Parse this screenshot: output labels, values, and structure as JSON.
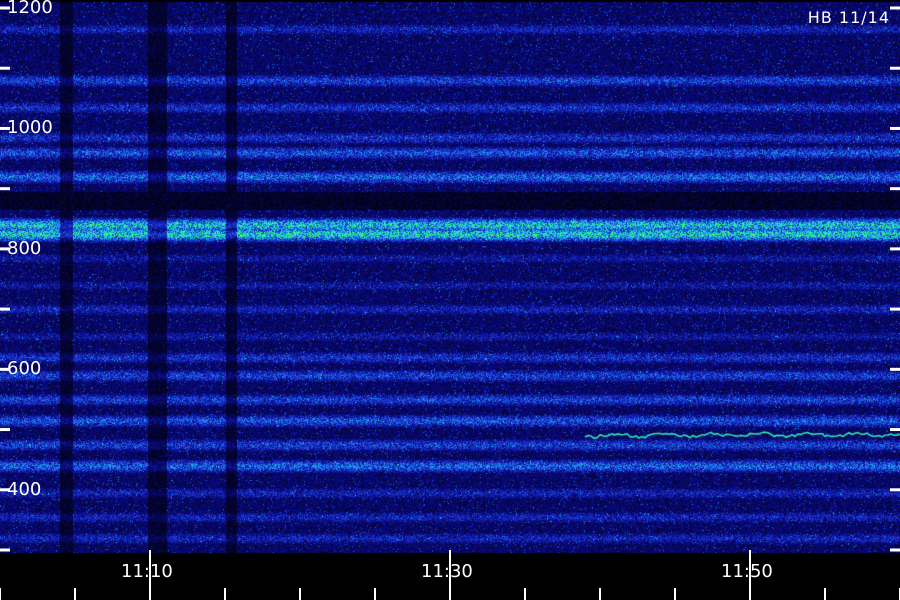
{
  "chart_data": {
    "type": "heatmap",
    "annotation": "HB 11/14",
    "y_axis": {
      "range": [
        300,
        1200
      ],
      "labels": [
        "1200",
        "1000",
        "800",
        "600",
        "400"
      ],
      "label_values": [
        1200,
        1000,
        800,
        600,
        400
      ],
      "tick_values": [
        1100,
        900,
        700,
        500,
        300
      ]
    },
    "x_axis": {
      "labels": [
        "11:10",
        "11:30",
        "11:50"
      ],
      "label_values": [
        "11:10",
        "11:30",
        "11:50"
      ],
      "range": [
        "11:00",
        "12:00"
      ]
    },
    "bands": [
      {
        "level": 1165,
        "intensity": 0.35
      },
      {
        "level": 1080,
        "intensity": 0.45
      },
      {
        "level": 1035,
        "intensity": 0.4
      },
      {
        "level": 985,
        "intensity": 0.4
      },
      {
        "level": 960,
        "intensity": 0.5
      },
      {
        "level": 920,
        "intensity": 0.55
      },
      {
        "level": 880,
        "intensity": 0.05
      },
      {
        "level": 840,
        "intensity": 0.85
      },
      {
        "level": 825,
        "intensity": 0.9
      },
      {
        "level": 785,
        "intensity": 0.3
      },
      {
        "level": 740,
        "intensity": 0.3
      },
      {
        "level": 700,
        "intensity": 0.35
      },
      {
        "level": 655,
        "intensity": 0.3
      },
      {
        "level": 620,
        "intensity": 0.4
      },
      {
        "level": 590,
        "intensity": 0.45
      },
      {
        "level": 550,
        "intensity": 0.45
      },
      {
        "level": 515,
        "intensity": 0.5
      },
      {
        "level": 475,
        "intensity": 0.45
      },
      {
        "level": 440,
        "intensity": 0.55
      },
      {
        "level": 395,
        "intensity": 0.35
      },
      {
        "level": 355,
        "intensity": 0.35
      },
      {
        "level": 320,
        "intensity": 0.35
      }
    ],
    "trace": {
      "start_time": "11:39",
      "end_time": "12:00",
      "level": 490
    },
    "colors": [
      "#000000",
      "#0a0a8c",
      "#1f3fe0",
      "#1aa0f0",
      "#20e0d0",
      "#40ff60"
    ]
  }
}
